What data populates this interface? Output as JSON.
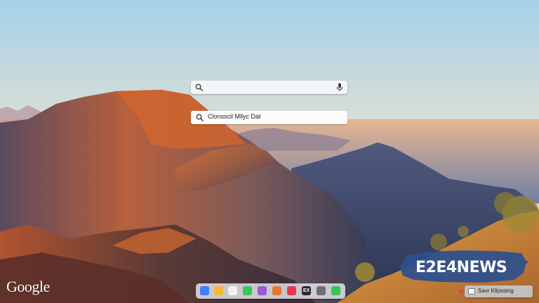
{
  "search": {
    "value": "",
    "placeholder": ""
  },
  "suggestion": {
    "text": "Clonsscil Mllyc Dat"
  },
  "branding": {
    "google_logo": "Google",
    "news_logo": "E2E4NEWS"
  },
  "dock": {
    "items": [
      {
        "icon": "finder-icon",
        "label": "",
        "color": "#3b82f6"
      },
      {
        "icon": "notes-icon",
        "label": "",
        "color": "#f5b83a"
      },
      {
        "icon": "calendar-icon",
        "label": "",
        "color": "#f2f2f2"
      },
      {
        "icon": "messages-icon",
        "label": "",
        "color": "#34c759"
      },
      {
        "icon": "podcasts-icon",
        "label": "",
        "color": "#9b59d6"
      },
      {
        "icon": "chrome-icon",
        "label": "",
        "color": "#e6772e"
      },
      {
        "icon": "music-icon",
        "label": "",
        "color": "#e63950"
      },
      {
        "icon": "terminal-icon",
        "label": "EX",
        "color": "#2b2b2b"
      },
      {
        "icon": "settings-icon",
        "label": "",
        "color": "#6e6e73"
      },
      {
        "icon": "facetime-icon",
        "label": "",
        "color": "#3cc15a"
      }
    ]
  },
  "tray": {
    "text": "Savr Klipssing"
  },
  "colors": {
    "sky_top": "#a9d3e8",
    "sky_horizon": "#f2b07a",
    "accent": "#2f6fd0"
  }
}
